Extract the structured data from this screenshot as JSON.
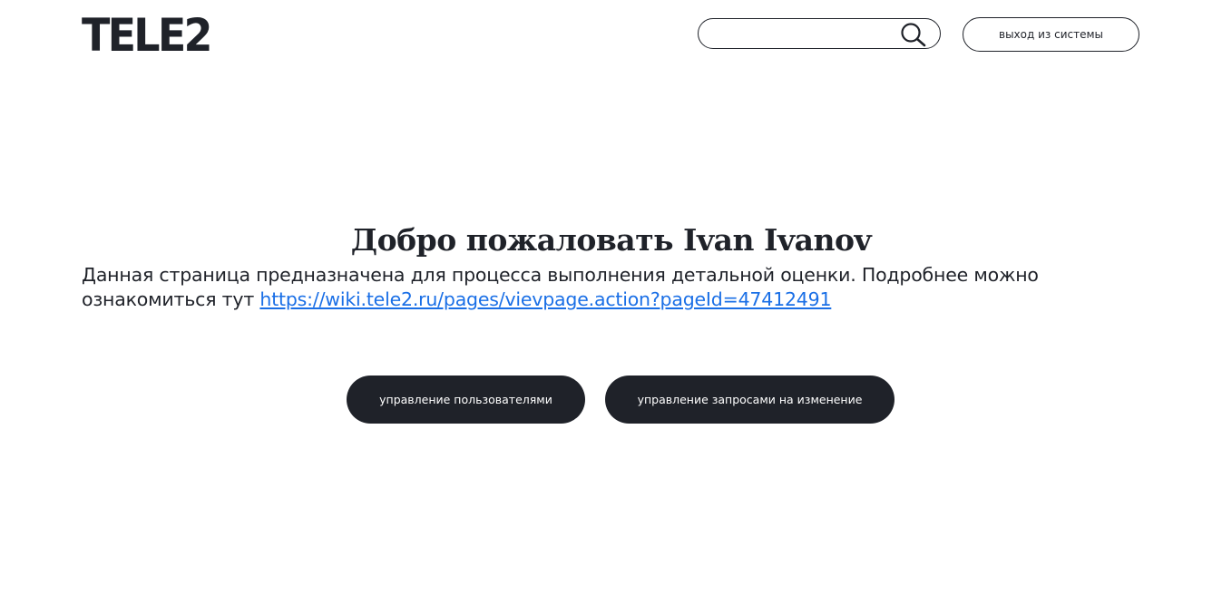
{
  "header": {
    "logo_text": "TELE2",
    "search": {
      "value": "",
      "placeholder": ""
    },
    "logout_label": "выход из системы"
  },
  "main": {
    "welcome_title": "Добро пожаловать Ivan Ivanov",
    "description_text": "Данная страница предназначена для процесса выполнения детальной оценки. Подробнее можно ознакомиться тут ",
    "wiki_link_text": "https://wiki.tele2.ru/pages/vievpage.action?pageId=47412491",
    "buttons": {
      "users_label": "управление пользователями",
      "change_requests_label": "управление запросами на изменение"
    }
  },
  "icons": {
    "search": "search-icon"
  },
  "colors": {
    "primary_dark": "#1f2229",
    "link": "#1a6fe6",
    "background": "#ffffff"
  }
}
